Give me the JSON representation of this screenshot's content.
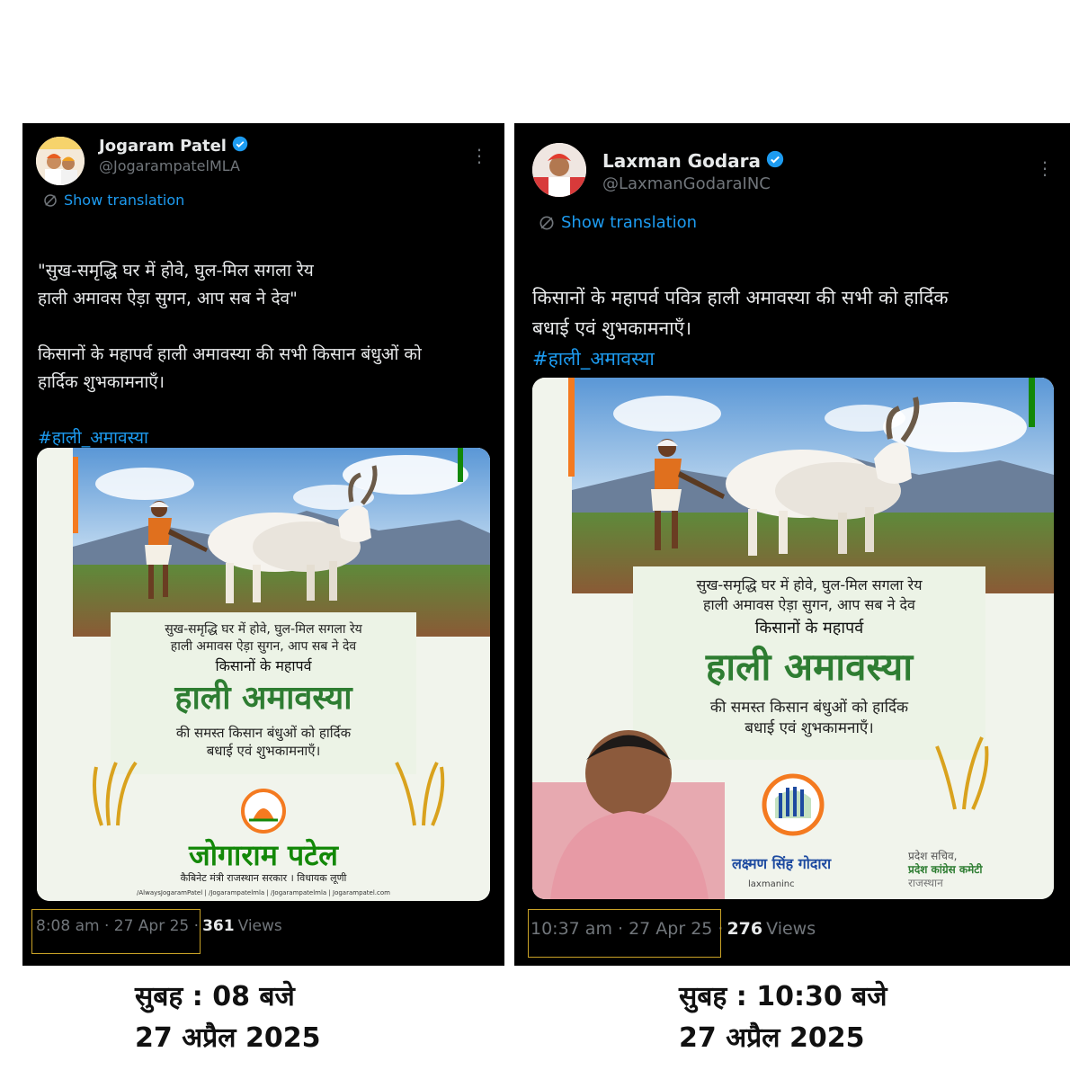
{
  "left_tweet": {
    "display_name": "Jogaram Patel",
    "handle": "@JogarampatelMLA",
    "translate_label": "Show translation",
    "body": "\"सुख-समृद्धि घर में होवे, घुल-मिल सगला रेय\nहाली अमावस ऐड़ा सुगन, आप सब ने देव\"\n\nकिसानों के महापर्व हाली अमावस्या की सभी किसान बंधुओं को\nहार्दिक शुभकामनाएँ।\n",
    "hashtag": "#हाली_अमावस्या",
    "poster": {
      "couplet_line1": "सुख-समृद्धि घर में होवे, घुल-मिल सगला रेय",
      "couplet_line2": "हाली अमावस ऐड़ा सुगन, आप सब ने देव",
      "festival_of": "किसानों के महापर्व",
      "festival_name": "हाली अमावस्या",
      "wish_line1": "की समस्त किसान बंधुओं को हार्दिक",
      "wish_line2": "बधाई एवं शुभकामनाएँ।",
      "leader_name": "जोगाराम पटेल",
      "leader_title": "कैबिनेट मंत्री राजस्थान सरकार । विधायक लूणी",
      "social_line": "/AlwaysJogaramPatel | /Jogarampatelmla | /Jogarampatelmla | Jogarampatel.com"
    },
    "timestamp": "8:08 am · 27 Apr 25 ·",
    "views_count": "361",
    "views_label": "Views"
  },
  "right_tweet": {
    "display_name": "Laxman Godara",
    "handle": "@LaxmanGodaraINC",
    "translate_label": "Show translation",
    "body": "किसानों के महापर्व पवित्र हाली अमावस्या की सभी को हार्दिक\nबधाई एवं शुभकामनाएँ।",
    "hashtag": "#हाली_अमावस्या",
    "poster": {
      "couplet_line1": "सुख-समृद्धि घर में होवे, घुल-मिल सगला रेय",
      "couplet_line2": "हाली अमावस ऐड़ा सुगन, आप सब ने देव",
      "festival_of": "किसानों के महापर्व",
      "festival_name": "हाली अमावस्या",
      "wish_line1": "की समस्त किसान बंधुओं को हार्दिक",
      "wish_line2": "बधाई एवं शुभकामनाएँ।",
      "leader_name": "लक्ष्मण सिंह गोदारा",
      "social_handle": "laxmaninc",
      "designation_line1": "प्रदेश सचिव,",
      "designation_line2": "प्रदेश कांग्रेस कमेटी",
      "designation_line3": "राजस्थान"
    },
    "timestamp": "10:37 am · 27 Apr 25 ·",
    "views_count": "276",
    "views_label": "Views"
  },
  "captions": {
    "left_time": "सुबह : 08 बजे",
    "left_date": "27 अप्रैल 2025",
    "right_time": "सुबह : 10:30 बजे",
    "right_date": "27 अप्रैल 2025"
  },
  "colors": {
    "tweet_bg": "#000000",
    "link_blue": "#1d9bf0",
    "verified_blue": "#1d9bf0",
    "highlight_box": "#c9a227",
    "saffron": "#f47a20",
    "india_green": "#138808",
    "poster_green_text": "#2e7d32"
  }
}
